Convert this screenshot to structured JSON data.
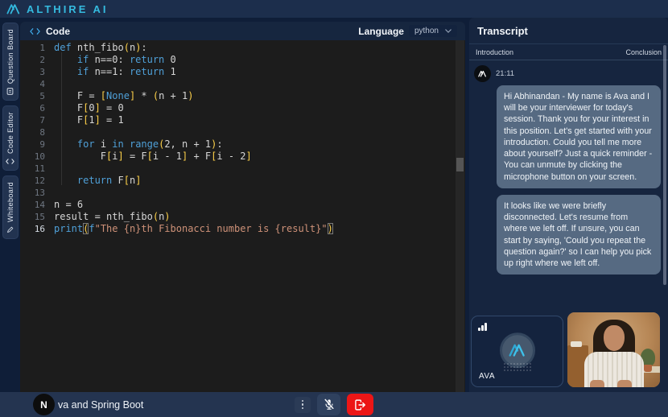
{
  "header": {
    "brand": "ALTHIRE AI"
  },
  "sidebar": {
    "tabs": [
      {
        "label": "Question Board",
        "icon": "clipboard-icon"
      },
      {
        "label": "Code Editor",
        "icon": "code-icon"
      },
      {
        "label": "Whiteboard",
        "icon": "pen-icon"
      }
    ]
  },
  "code_panel": {
    "title": "Code",
    "icon": "code-icon",
    "language_label": "Language",
    "language_value": "python"
  },
  "editor": {
    "active_line": 16,
    "lines": [
      {
        "n": 1,
        "t": [
          [
            "k",
            "def"
          ],
          [
            "p",
            " nth_fibo"
          ],
          [
            "b",
            "("
          ],
          [
            "p",
            "n"
          ],
          [
            "b",
            ")"
          ],
          [
            "p",
            ":"
          ]
        ]
      },
      {
        "n": 2,
        "t": [
          [
            "p",
            "    "
          ],
          [
            "k",
            "if"
          ],
          [
            "p",
            " n==0: "
          ],
          [
            "k",
            "return"
          ],
          [
            "p",
            " 0"
          ]
        ]
      },
      {
        "n": 3,
        "t": [
          [
            "p",
            "    "
          ],
          [
            "k",
            "if"
          ],
          [
            "p",
            " n==1: "
          ],
          [
            "k",
            "return"
          ],
          [
            "p",
            " 1"
          ]
        ]
      },
      {
        "n": 4,
        "t": []
      },
      {
        "n": 5,
        "t": [
          [
            "p",
            "    F = "
          ],
          [
            "b",
            "["
          ],
          [
            "k",
            "None"
          ],
          [
            "b",
            "]"
          ],
          [
            "p",
            " * "
          ],
          [
            "b",
            "("
          ],
          [
            "p",
            "n + 1"
          ],
          [
            "b",
            ")"
          ]
        ]
      },
      {
        "n": 6,
        "t": [
          [
            "p",
            "    F"
          ],
          [
            "b",
            "["
          ],
          [
            "p",
            "0"
          ],
          [
            "b",
            "]"
          ],
          [
            "p",
            " = 0"
          ]
        ]
      },
      {
        "n": 7,
        "t": [
          [
            "p",
            "    F"
          ],
          [
            "b",
            "["
          ],
          [
            "p",
            "1"
          ],
          [
            "b",
            "]"
          ],
          [
            "p",
            " = 1"
          ]
        ]
      },
      {
        "n": 8,
        "t": []
      },
      {
        "n": 9,
        "t": [
          [
            "p",
            "    "
          ],
          [
            "k",
            "for"
          ],
          [
            "p",
            " i "
          ],
          [
            "k",
            "in"
          ],
          [
            "p",
            " "
          ],
          [
            "k",
            "range"
          ],
          [
            "b",
            "("
          ],
          [
            "p",
            "2, n + 1"
          ],
          [
            "b",
            ")"
          ],
          [
            "p",
            ":"
          ]
        ]
      },
      {
        "n": 10,
        "t": [
          [
            "p",
            "        F"
          ],
          [
            "b",
            "["
          ],
          [
            "p",
            "i"
          ],
          [
            "b",
            "]"
          ],
          [
            "p",
            " = F"
          ],
          [
            "b",
            "["
          ],
          [
            "p",
            "i - 1"
          ],
          [
            "b",
            "]"
          ],
          [
            "p",
            " + F"
          ],
          [
            "b",
            "["
          ],
          [
            "p",
            "i - 2"
          ],
          [
            "b",
            "]"
          ]
        ]
      },
      {
        "n": 11,
        "t": []
      },
      {
        "n": 12,
        "t": [
          [
            "p",
            "    "
          ],
          [
            "k",
            "return"
          ],
          [
            "p",
            " F"
          ],
          [
            "b",
            "["
          ],
          [
            "p",
            "n"
          ],
          [
            "b",
            "]"
          ]
        ]
      },
      {
        "n": 13,
        "t": []
      },
      {
        "n": 14,
        "t": [
          [
            "p",
            "n = 6"
          ]
        ]
      },
      {
        "n": 15,
        "t": [
          [
            "p",
            "result = nth_fibo"
          ],
          [
            "b",
            "("
          ],
          [
            "p",
            "n"
          ],
          [
            "b",
            ")"
          ]
        ]
      },
      {
        "n": 16,
        "t": [
          [
            "k",
            "print"
          ],
          [
            "m",
            "("
          ],
          [
            "k",
            "f"
          ],
          [
            "s",
            "\"The {n}th Fibonacci number is {result}\""
          ],
          [
            "m",
            ")"
          ]
        ]
      }
    ]
  },
  "transcript": {
    "title": "Transcript",
    "stage_start": "Introduction",
    "stage_end": "Conclusion",
    "messages": [
      {
        "time": "21:11",
        "text": "Hi Abhinandan - My name is Ava and I will be your interviewer for today's session. Thank you for your interest in this position. Let's get started with your introduction. Could you tell me more about yourself? Just a quick reminder - You can unmute by clicking the microphone button on your screen."
      },
      {
        "text": "It looks like we were briefly disconnected. Let's resume from where we left off. If unsure, you can start by saying, 'Could you repeat the question again?' so I can help you pick up right where we left off."
      }
    ]
  },
  "videos": {
    "ava_label": "AVA"
  },
  "bottom_bar": {
    "avatar_initial": "N",
    "session_label": "va and Spring Boot"
  },
  "icons": {
    "brand": "althire-logo-icon",
    "signal": "signal-bars-icon",
    "menu": "kebab-menu-icon",
    "mic": "mic-off-icon",
    "leave": "leave-call-icon",
    "language_chevron": "chevron-down-icon"
  },
  "colors": {
    "accent_cyan": "#35bbdf",
    "header_bg": "#1c2e4c",
    "page_bg": "#0f1e38",
    "panel_bg": "#16253f",
    "editor_bg": "#1c1c1c",
    "bubble_bg": "#566a82",
    "bottom_bar_bg": "#243450",
    "leave_red": "#ec1616",
    "keyword_blue": "#4fa0d8",
    "string_orange": "#ce9178",
    "bracket_yellow": "#ffd24a"
  }
}
